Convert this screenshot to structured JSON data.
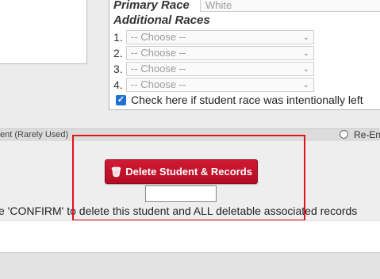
{
  "race": {
    "primary_label": "Primary Race",
    "primary_value": "White",
    "additional_label": "Additional Races",
    "rows": [
      {
        "num": "1.",
        "value": "-- Choose --"
      },
      {
        "num": "2.",
        "value": "-- Choose --"
      },
      {
        "num": "3.",
        "value": "-- Choose --"
      },
      {
        "num": "4.",
        "value": "-- Choose --"
      }
    ],
    "check_label": "Check here if student race was intentionally left"
  },
  "strip": {
    "left_text": "ent (Rarely Used)",
    "right_text": "Re-En"
  },
  "delete": {
    "button_label": "Delete Student & Records",
    "confirm_value": "",
    "instruction": "e 'CONFIRM' to delete this student and ALL deletable associated records"
  },
  "icons": {
    "trash": "trash-icon",
    "check": "checkmark-icon",
    "chevron": "chevron-down-icon"
  },
  "colors": {
    "button": "#c21329",
    "highlight": "#e0151b",
    "checkbox": "#1f6fd6"
  }
}
